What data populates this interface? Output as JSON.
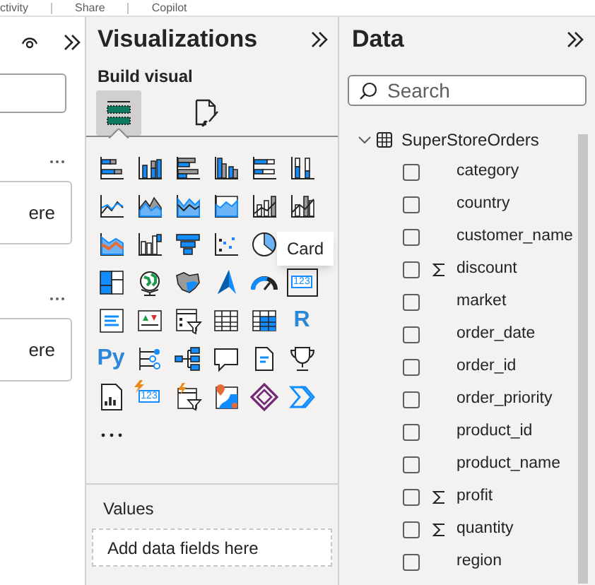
{
  "top_bar": {
    "items": [
      "ctivity",
      "Share",
      "Copilot"
    ]
  },
  "left_pane": {
    "cards": [
      {
        "text": "ere"
      },
      {
        "text": "ere"
      }
    ]
  },
  "visualizations": {
    "title": "Visualizations",
    "subtitle": "Build visual",
    "view_tabs": [
      {
        "kind": "build",
        "selected": true
      },
      {
        "kind": "format",
        "selected": false
      }
    ],
    "visuals": [
      {
        "kind": "stacked-bar"
      },
      {
        "kind": "stacked-column"
      },
      {
        "kind": "clustered-bar"
      },
      {
        "kind": "clustered-column"
      },
      {
        "kind": "stacked-bar-100"
      },
      {
        "kind": "stacked-column-100"
      },
      {
        "kind": "line"
      },
      {
        "kind": "area"
      },
      {
        "kind": "stacked-area"
      },
      {
        "kind": "stacked-area-100"
      },
      {
        "kind": "line-column"
      },
      {
        "kind": "line-clustered-column"
      },
      {
        "kind": "ribbon"
      },
      {
        "kind": "waterfall"
      },
      {
        "kind": "funnel"
      },
      {
        "kind": "scatter"
      },
      {
        "kind": "pie"
      },
      {
        "kind": "hidden"
      },
      {
        "kind": "treemap"
      },
      {
        "kind": "globe"
      },
      {
        "kind": "filled-map"
      },
      {
        "kind": "arrow"
      },
      {
        "kind": "gauge"
      },
      {
        "kind": "card",
        "label": "123",
        "tooltip": "Card"
      },
      {
        "kind": "multi-row-card"
      },
      {
        "kind": "kpi"
      },
      {
        "kind": "slicer"
      },
      {
        "kind": "table"
      },
      {
        "kind": "matrix"
      },
      {
        "kind": "script",
        "label": "R"
      },
      {
        "kind": "script",
        "label": "Py"
      },
      {
        "kind": "key-influencers"
      },
      {
        "kind": "decomposition-tree"
      },
      {
        "kind": "speech"
      },
      {
        "kind": "document"
      },
      {
        "kind": "trophy"
      },
      {
        "kind": "report"
      },
      {
        "kind": "flash-card",
        "label": "123"
      },
      {
        "kind": "flash-slicer"
      },
      {
        "kind": "map-pin"
      },
      {
        "kind": "diamond"
      },
      {
        "kind": "chevrons"
      },
      {
        "kind": "more"
      }
    ],
    "values_label": "Values",
    "values_placeholder": "Add data fields here"
  },
  "data": {
    "title": "Data",
    "search": {
      "placeholder": "Search"
    },
    "table": {
      "name": "SuperStoreOrders",
      "expanded": true,
      "fields": [
        {
          "name": "category",
          "kind": "text",
          "checked": false
        },
        {
          "name": "country",
          "kind": "text",
          "checked": false
        },
        {
          "name": "customer_name",
          "kind": "text",
          "checked": false
        },
        {
          "name": "discount",
          "kind": "numeric",
          "checked": false
        },
        {
          "name": "market",
          "kind": "text",
          "checked": false
        },
        {
          "name": "order_date",
          "kind": "text",
          "checked": false
        },
        {
          "name": "order_id",
          "kind": "text",
          "checked": false
        },
        {
          "name": "order_priority",
          "kind": "text",
          "checked": false
        },
        {
          "name": "product_id",
          "kind": "text",
          "checked": false
        },
        {
          "name": "product_name",
          "kind": "text",
          "checked": false
        },
        {
          "name": "profit",
          "kind": "numeric",
          "checked": false
        },
        {
          "name": "quantity",
          "kind": "numeric",
          "checked": false
        },
        {
          "name": "region",
          "kind": "text",
          "checked": false
        }
      ]
    }
  }
}
